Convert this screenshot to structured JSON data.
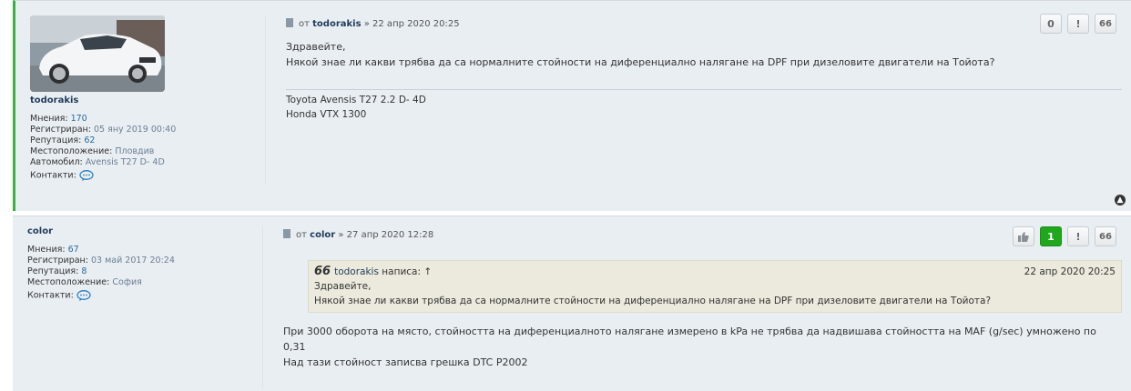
{
  "posts": [
    {
      "author": "todorakis",
      "profile": {
        "posts_label": "Мнения:",
        "posts_value": "170",
        "registered_label": "Регистриран:",
        "registered_value": "05 яну 2019 00:40",
        "reputation_label": "Репутация:",
        "reputation_value": "62",
        "location_label": "Местоположение:",
        "location_value": "Пловдив",
        "car_label": "Автомобил:",
        "car_value": "Avensis T27 D- 4D",
        "contacts_label": "Контакти:"
      },
      "meta": {
        "from": "от",
        "sep": "»",
        "date": "22 апр 2020 20:25"
      },
      "buttons": {
        "rep": "0",
        "report": "!",
        "quote": "66"
      },
      "content": [
        "Здравейте,",
        "Някой знае ли какви трябва да са нормалните стойности на диференциално налягане на DPF при дизеловите двигатели на Тойота?"
      ],
      "signature": [
        "Toyota Avensis T27 2.2 D- 4D",
        "Honda VTX 1300"
      ]
    },
    {
      "author": "color",
      "profile": {
        "posts_label": "Мнения:",
        "posts_value": "67",
        "registered_label": "Регистриран:",
        "registered_value": "03 май 2017 20:24",
        "reputation_label": "Репутация:",
        "reputation_value": "8",
        "location_label": "Местоположение:",
        "location_value": "София",
        "contacts_label": "Контакти:"
      },
      "meta": {
        "from": "от",
        "sep": "»",
        "date": "27 апр 2020 12:28"
      },
      "buttons": {
        "rep": "1",
        "report": "!",
        "quote": "66"
      },
      "quote": {
        "author": "todorakis",
        "wrote": "написа: ↑",
        "date": "22 апр 2020 20:25",
        "lines": [
          "Здравейте,",
          "Някой знае ли какви трябва да са нормалните стойности на диференциално налягане на DPF при дизеловите двигатели на Тойота?"
        ]
      },
      "content": [
        "При 3000 оборота на място, стойността на диференциалното налягане измерено в kPa не трябва да надвишава стойността на MAF (g/sec) умножено по",
        "0,31",
        "Над тази стойност записва грешка DTC P2002"
      ]
    }
  ],
  "colors": {
    "post_bg": "#e9eef3",
    "author": "#1f3b5a",
    "online_border": "#3bb041",
    "rep_positive": "#20a81c"
  }
}
